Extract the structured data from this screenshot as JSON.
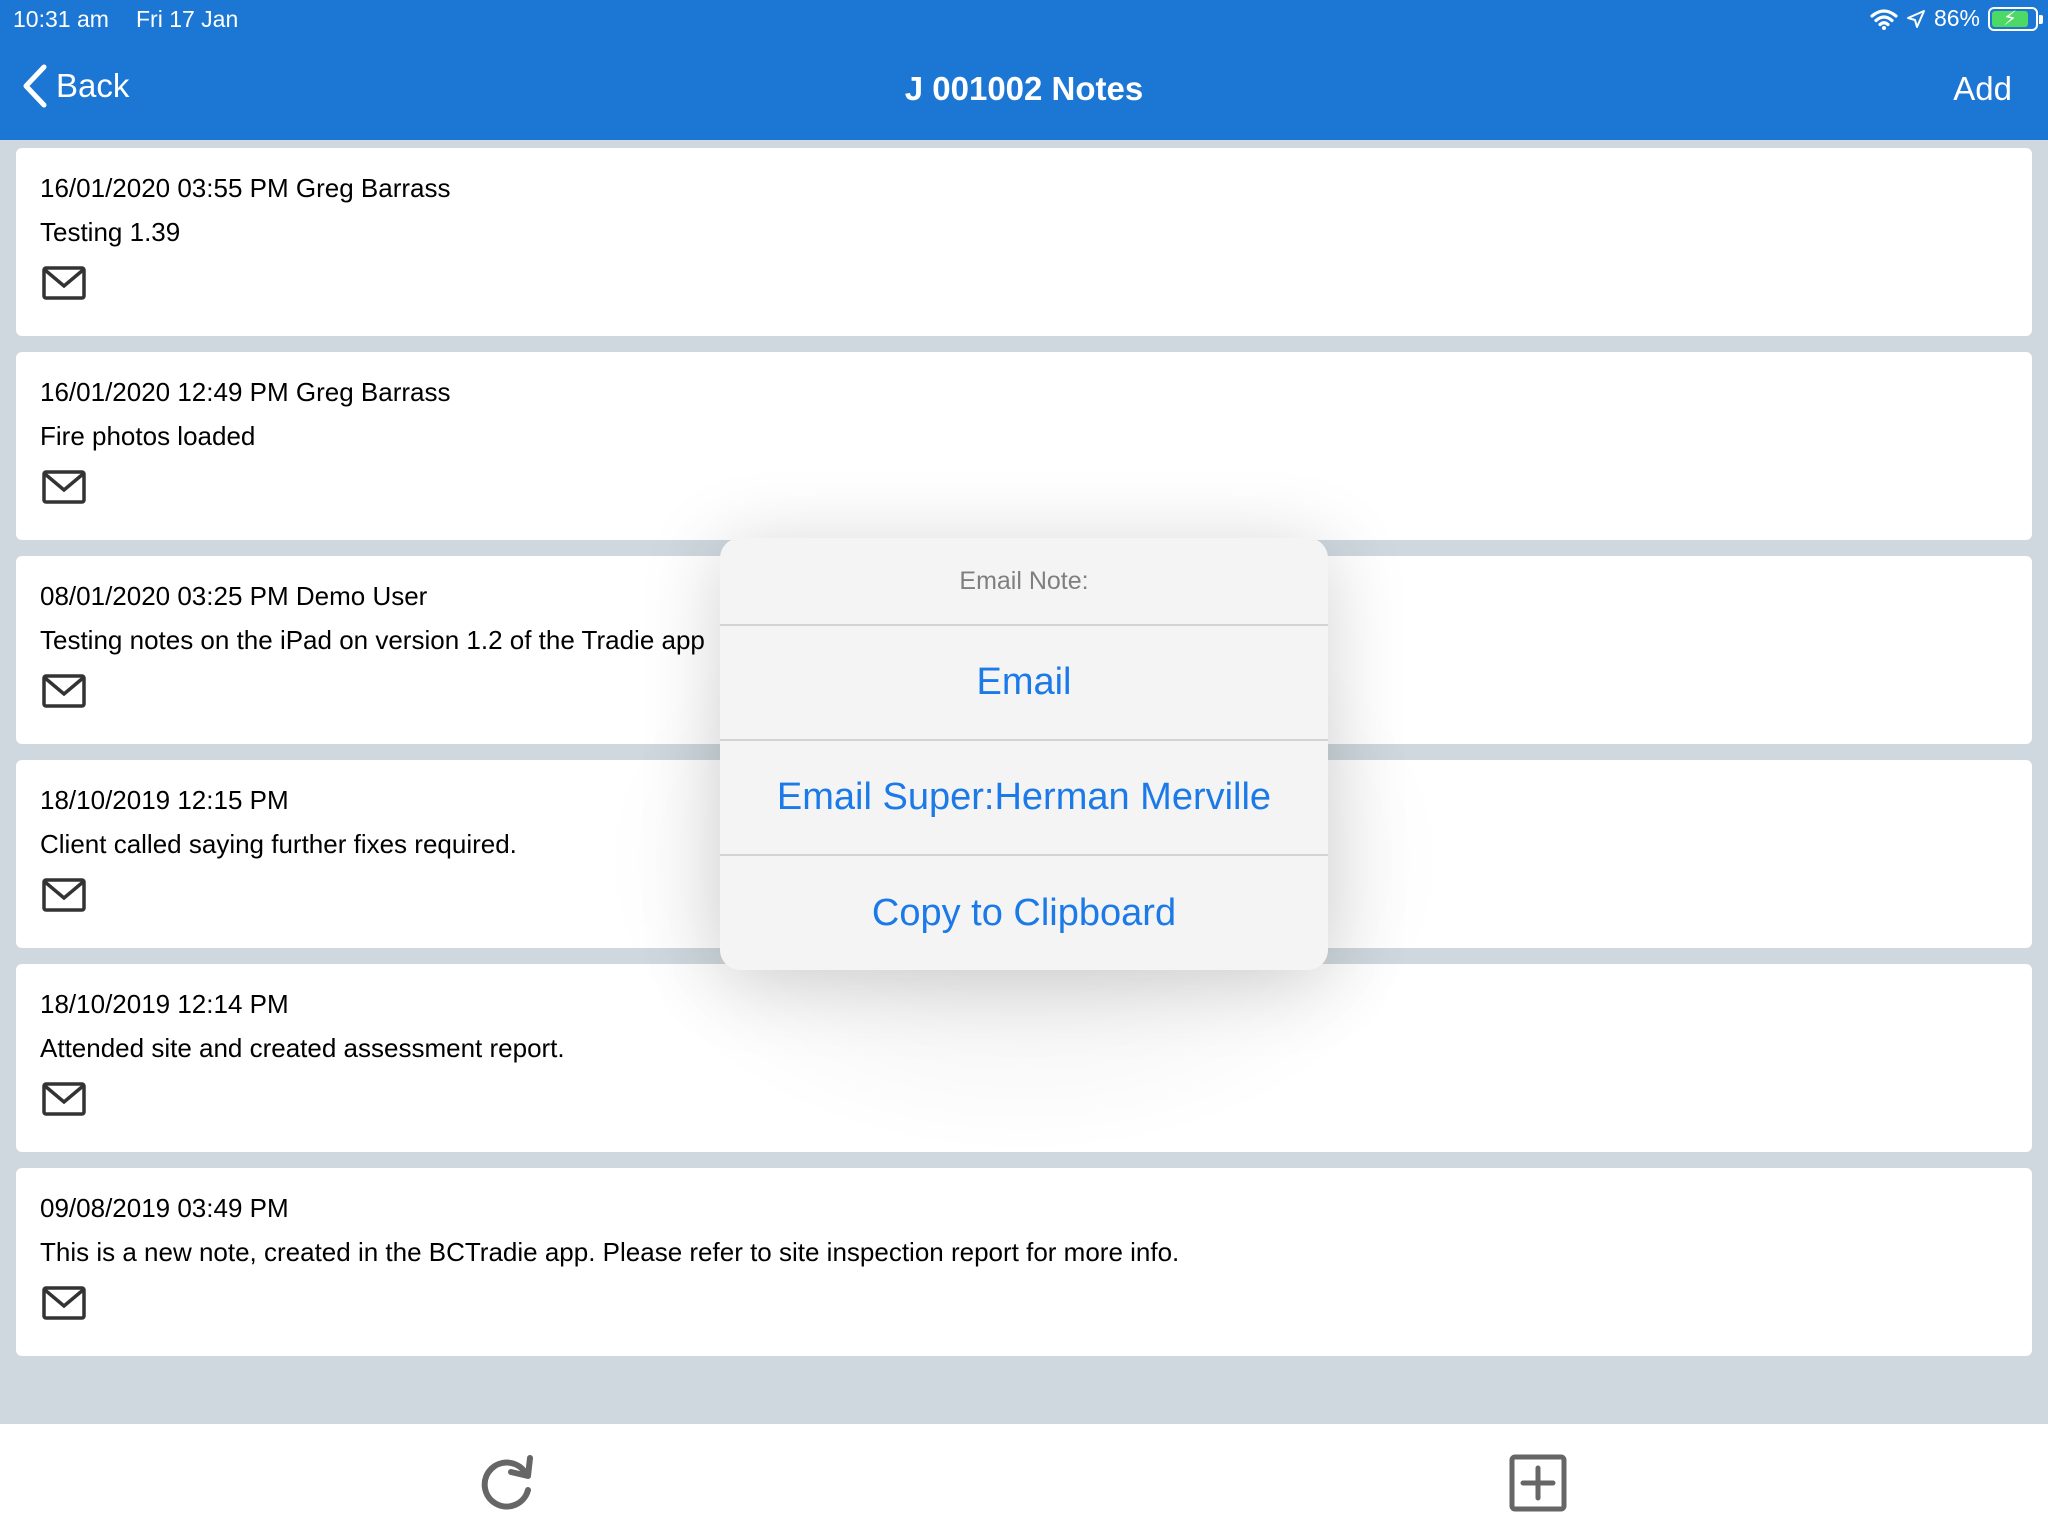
{
  "status_bar": {
    "time": "10:31 am",
    "date": "Fri 17 Jan",
    "battery": "86%"
  },
  "header": {
    "back_label": "Back",
    "title": "J 001002 Notes",
    "add_label": "Add"
  },
  "notes": [
    {
      "header": "16/01/2020 03:55 PM Greg Barrass",
      "text": "Testing 1.39"
    },
    {
      "header": "16/01/2020 12:49 PM Greg Barrass",
      "text": "Fire photos loaded"
    },
    {
      "header": "08/01/2020 03:25 PM Demo User",
      "text": "Testing notes on the iPad on version 1.2 of the Tradie app"
    },
    {
      "header": "18/10/2019 12:15 PM",
      "text": "Client called saying further fixes required."
    },
    {
      "header": "18/10/2019 12:14 PM",
      "text": "Attended site and created assessment report."
    },
    {
      "header": "09/08/2019 03:49 PM",
      "text": "This is a new note, created in the BCTradie app. Please refer to site inspection report for more info."
    }
  ],
  "popover": {
    "title": "Email Note:",
    "actions": [
      "Email",
      "Email Super:Herman Merville",
      "Copy to Clipboard"
    ]
  },
  "toolbar": {
    "icons": [
      "refresh-icon",
      "add-square-icon"
    ]
  },
  "colors": {
    "header_bg": "#1b76d4",
    "action_text": "#1b7ae8",
    "page_bg": "#cfd8de"
  }
}
